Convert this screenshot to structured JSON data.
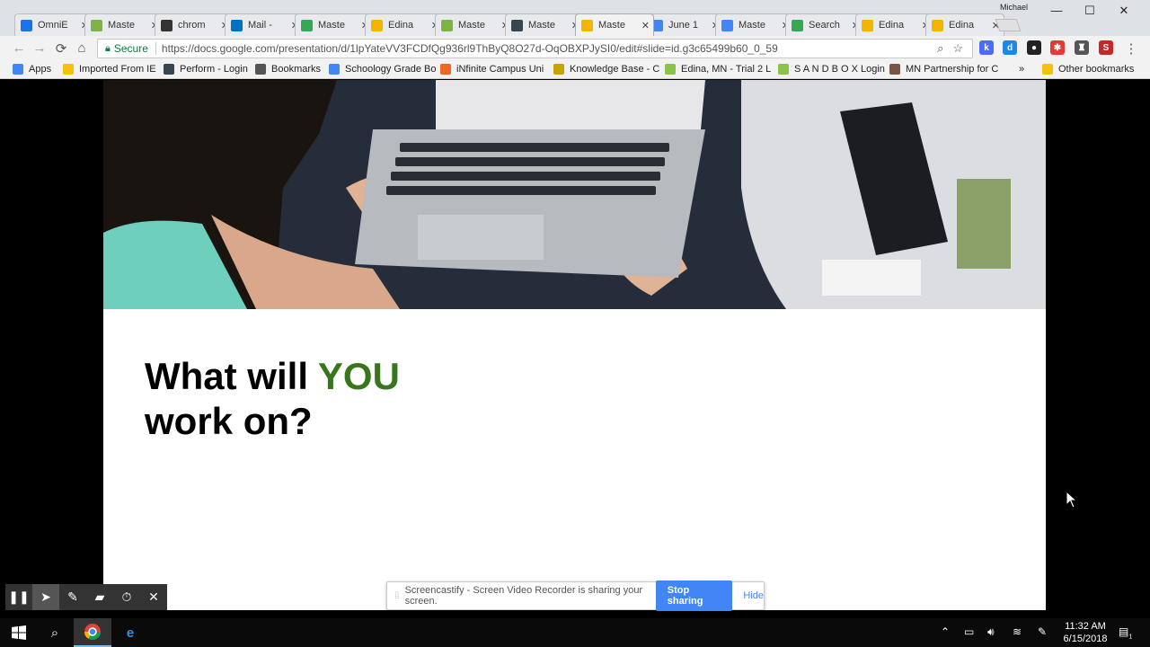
{
  "window": {
    "profile_name": "Michael",
    "controls": {
      "minimize": "—",
      "maximize": "☐",
      "close": "✕"
    }
  },
  "tabs": [
    {
      "title": "OmniE",
      "favicon_color": "#1a73e8"
    },
    {
      "title": "Maste",
      "favicon_color": "#7cb342"
    },
    {
      "title": "chrom",
      "favicon_color": "#333333"
    },
    {
      "title": "Mail -",
      "favicon_color": "#0072c6"
    },
    {
      "title": "Maste",
      "favicon_color": "#34a853"
    },
    {
      "title": "Edina",
      "favicon_color": "#f4b400"
    },
    {
      "title": "Maste",
      "favicon_color": "#7cb342"
    },
    {
      "title": "Maste",
      "favicon_color": "#37474f"
    },
    {
      "title": "Maste",
      "favicon_color": "#f4b400",
      "active": true
    },
    {
      "title": "June 1",
      "favicon_color": "#4285f4"
    },
    {
      "title": "Maste",
      "favicon_color": "#4285f4"
    },
    {
      "title": "Search",
      "favicon_color": "#34a853"
    },
    {
      "title": "Edina",
      "favicon_color": "#f4b400"
    },
    {
      "title": "Edina",
      "favicon_color": "#f4b400"
    }
  ],
  "toolbar": {
    "back_icon": "←",
    "forward_icon": "→",
    "reload_icon": "⟳",
    "home_icon": "⌂",
    "security_label": "Secure",
    "url": "https://docs.google.com/presentation/d/1lpYateVV3FCDfQg936rl9ThByQ8O27d-OqOBXPJySI0/edit#slide=id.g3c65499b60_0_59",
    "extensions": [
      {
        "name": "k",
        "color": "#4a6cf7"
      },
      {
        "name": "d",
        "color": "#1e88e5"
      },
      {
        "name": "●",
        "color": "#222222"
      },
      {
        "name": "✱",
        "color": "#e53935"
      },
      {
        "name": "♜",
        "color": "#555555"
      },
      {
        "name": "S",
        "color": "#c62828"
      }
    ]
  },
  "bookmarks": [
    {
      "label": "Apps",
      "icon_color": "#4285f4"
    },
    {
      "label": "Imported From IE",
      "icon_color": "#f4c20d"
    },
    {
      "label": "Perform - Login",
      "icon_color": "#37474f"
    },
    {
      "label": "Bookmarks",
      "icon_color": "#555555"
    },
    {
      "label": "Schoology Grade Bo",
      "icon_color": "#4285f4"
    },
    {
      "label": "iNfinite Campus Uni",
      "icon_color": "#f26522"
    },
    {
      "label": "Knowledge Base - C",
      "icon_color": "#c9a400"
    },
    {
      "label": "Edina, MN - Trial 2 L",
      "icon_color": "#8bc34a"
    },
    {
      "label": "S A N D B O X Login",
      "icon_color": "#8bc34a"
    },
    {
      "label": "MN Partnership for C",
      "icon_color": "#795548"
    },
    {
      "label": "»",
      "icon_color": ""
    },
    {
      "label": "Other bookmarks",
      "icon_color": "#f4c20d"
    }
  ],
  "slide": {
    "title_line1_prefix": "What will ",
    "title_line1_accent": "YOU",
    "title_line2": "work on?",
    "accent_color": "#38761d"
  },
  "sharebar": {
    "message": "Screencastify - Screen Video Recorder is sharing your screen.",
    "stop_label": "Stop sharing",
    "hide_label": "Hide"
  },
  "castify_tools": [
    "pause",
    "pointer",
    "pen",
    "eraser",
    "timer",
    "close"
  ],
  "taskbar": {
    "time": "11:32 AM",
    "date": "6/15/2018",
    "notification_count": "1"
  }
}
